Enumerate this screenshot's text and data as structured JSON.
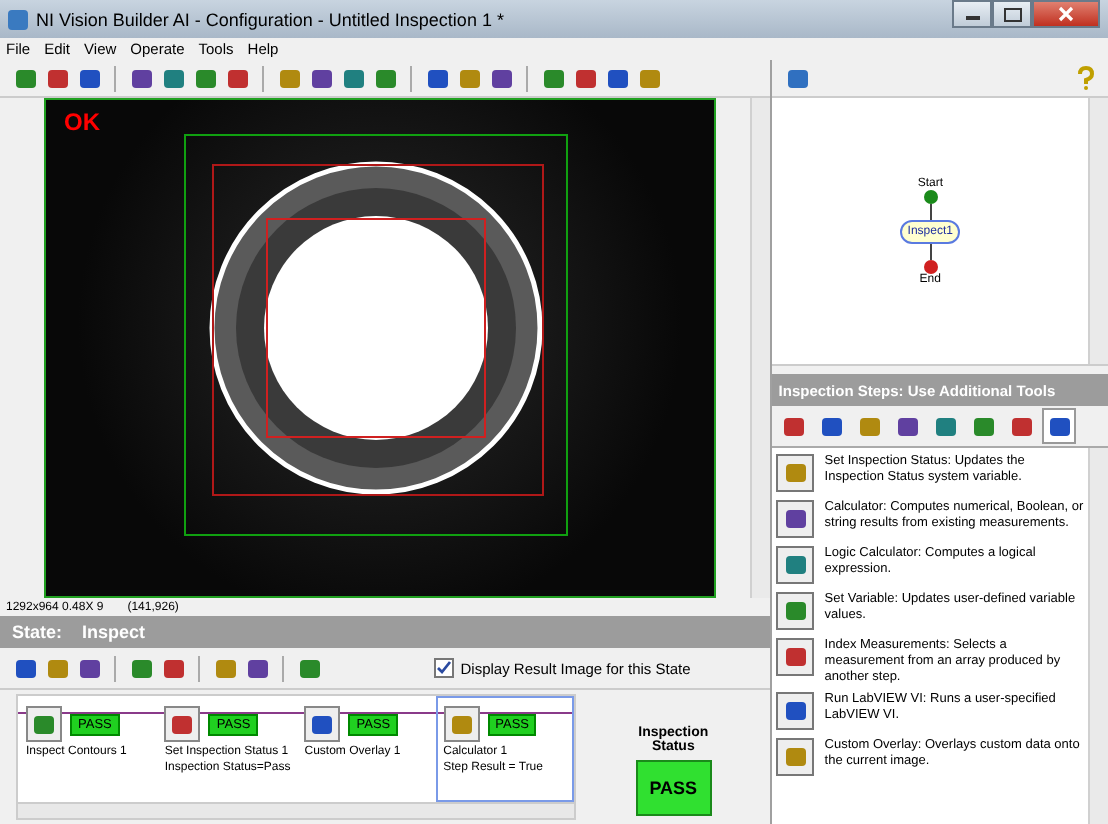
{
  "window": {
    "title": "NI Vision Builder AI - Configuration - Untitled Inspection 1 *"
  },
  "menu": [
    "File",
    "Edit",
    "View",
    "Operate",
    "Tools",
    "Help"
  ],
  "image": {
    "overlay_text": "OK",
    "info": "1292x964 0.48X 9",
    "coords": "(141,926)"
  },
  "state": {
    "label": "State:",
    "name": "Inspect"
  },
  "display_result": {
    "label": "Display Result Image for this State",
    "checked": true
  },
  "steps": [
    {
      "name": "Inspect Contours 1",
      "result": "PASS",
      "selected": false
    },
    {
      "name": "Set Inspection Status 1",
      "result": "PASS",
      "detail": "Inspection Status=Pass",
      "selected": false
    },
    {
      "name": "Custom Overlay 1",
      "result": "PASS",
      "selected": false
    },
    {
      "name": "Calculator 1",
      "result": "PASS",
      "detail": "Step Result = True",
      "selected": true
    }
  ],
  "inspection_status": {
    "label": "Inspection Status",
    "value": "PASS"
  },
  "flowchart": {
    "start": "Start",
    "state": "Inspect1",
    "end": "End"
  },
  "tools_header": "Inspection Steps: Use Additional Tools",
  "tool_tabs": [
    {
      "selected": false
    },
    {
      "selected": false
    },
    {
      "selected": false
    },
    {
      "selected": false
    },
    {
      "selected": false
    },
    {
      "selected": false
    },
    {
      "selected": false
    },
    {
      "selected": true
    }
  ],
  "tools": [
    "Set Inspection Status:  Updates the Inspection Status system variable.",
    "Calculator:  Computes numerical, Boolean, or string results from existing measurements.",
    "Logic Calculator:  Computes a logical expression.",
    "Set Variable:  Updates user-defined variable values.",
    "Index Measurements:  Selects a measurement from an array produced by another step.",
    "Run LabVIEW VI:  Runs a user-specified LabVIEW VI.",
    "Custom Overlay:  Overlays custom data onto the current image."
  ]
}
